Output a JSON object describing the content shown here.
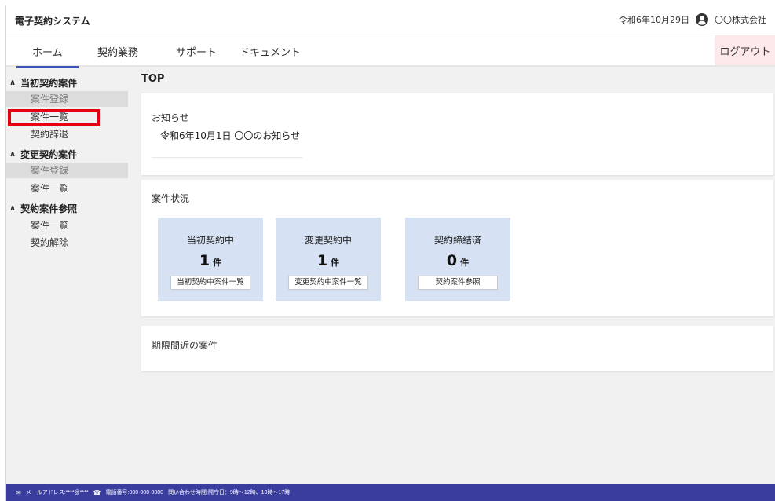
{
  "header": {
    "app_title": "電子契約システム",
    "date": "令和6年10月29日",
    "company": "〇〇株式会社"
  },
  "nav": {
    "tabs": [
      {
        "label": "ホーム",
        "active": true
      },
      {
        "label": "契約業務",
        "active": false
      },
      {
        "label": "サポート",
        "active": false
      },
      {
        "label": "ドキュメント",
        "active": false
      }
    ],
    "logout": "ログアウト"
  },
  "sidebar": {
    "groups": [
      {
        "label": "当初契約案件",
        "items": [
          {
            "label": "案件登録",
            "disabled": true
          },
          {
            "label": "案件一覧",
            "disabled": false,
            "highlighted": true
          },
          {
            "label": "契約辞退",
            "disabled": false
          }
        ]
      },
      {
        "label": "変更契約案件",
        "items": [
          {
            "label": "案件登録",
            "disabled": true
          },
          {
            "label": "案件一覧",
            "disabled": false
          }
        ]
      },
      {
        "label": "契約案件参照",
        "items": [
          {
            "label": "案件一覧",
            "disabled": false
          },
          {
            "label": "契約解除",
            "disabled": false
          }
        ]
      }
    ]
  },
  "main": {
    "title": "TOP",
    "notice": {
      "title": "お知らせ",
      "items": [
        "令和6年10月1日 〇〇のお知らせ"
      ]
    },
    "status": {
      "title": "案件状況",
      "boxes": [
        {
          "label": "当初契約中",
          "count": "1",
          "unit": "件",
          "button": "当初契約中案件一覧"
        },
        {
          "label": "変更契約中",
          "count": "1",
          "unit": "件",
          "button": "変更契約中案件一覧"
        },
        {
          "label": "契約締結済",
          "count": "0",
          "unit": "件",
          "button": "契約案件参照"
        }
      ]
    },
    "deadline": {
      "title": "期限間近の案件"
    }
  },
  "footer": {
    "email": "メールアドレス:****@****",
    "phone": "電話番号:000-000-0000",
    "hours": "問い合わせ時間:開庁日：9時～12時、13時～17時"
  },
  "colors": {
    "accent": "#3f52b5",
    "footer_bg": "#3a3d9e",
    "logout_bg": "#fde8ea",
    "status_box_bg": "#d6e2f3",
    "highlight": "#e60012"
  },
  "icons": {
    "user": "user-circle-icon",
    "mail": "mail-icon",
    "phone": "phone-icon",
    "chevron": "chevron-up-icon"
  }
}
